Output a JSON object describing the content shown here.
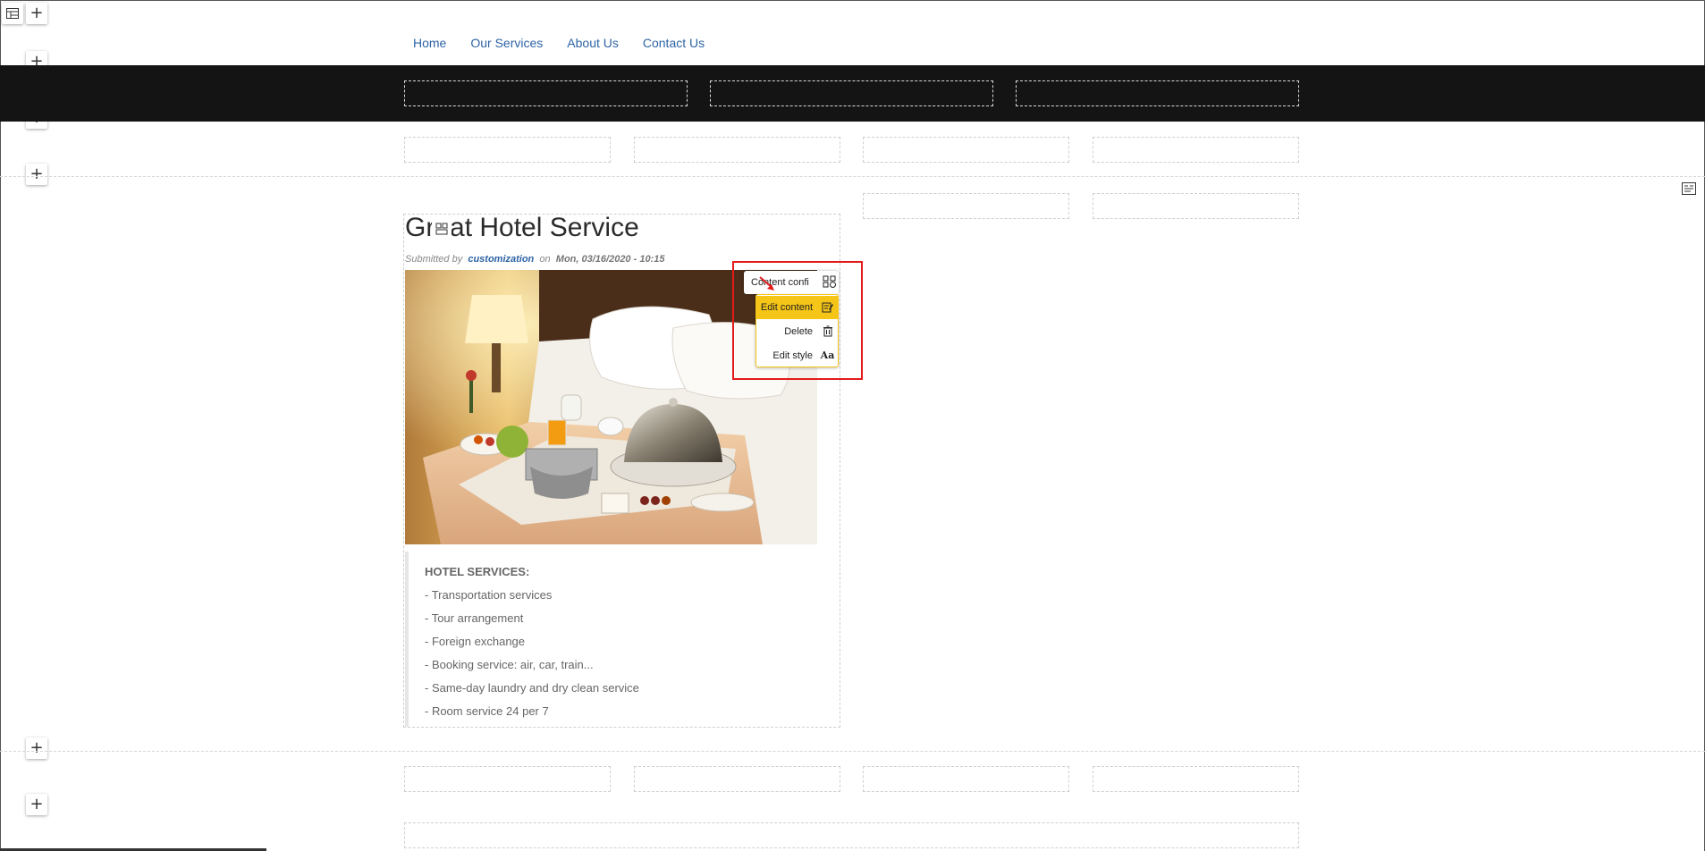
{
  "nav": {
    "items": [
      "Home",
      "Our Services",
      "About Us",
      "Contact Us"
    ]
  },
  "article": {
    "title": "Great Hotel Service",
    "submitted_by_label": "Submitted by",
    "author": "customization",
    "on_label": "on",
    "date": "Mon, 03/16/2020 - 10:15",
    "body_heading": "HOTEL SERVICES:",
    "body_lines": [
      "- Transportation services",
      "- Tour arrangement",
      "- Foreign exchange",
      "- Booking service: air, car, train...",
      "- Same-day laundry and dry clean service",
      "- Room service 24 per 7"
    ]
  },
  "context_menu": {
    "header_label": "Content confi",
    "items": [
      {
        "label": "Edit content",
        "icon": "edit-icon",
        "active": true
      },
      {
        "label": "Delete",
        "icon": "trash-icon",
        "active": false
      },
      {
        "label": "Edit style",
        "icon": "style-icon",
        "glyph": "Aa",
        "active": false
      }
    ]
  },
  "colors": {
    "link": "#2e64a5",
    "band": "#141414",
    "menu_active": "#f5c518",
    "highlight": "#e31b1b"
  }
}
